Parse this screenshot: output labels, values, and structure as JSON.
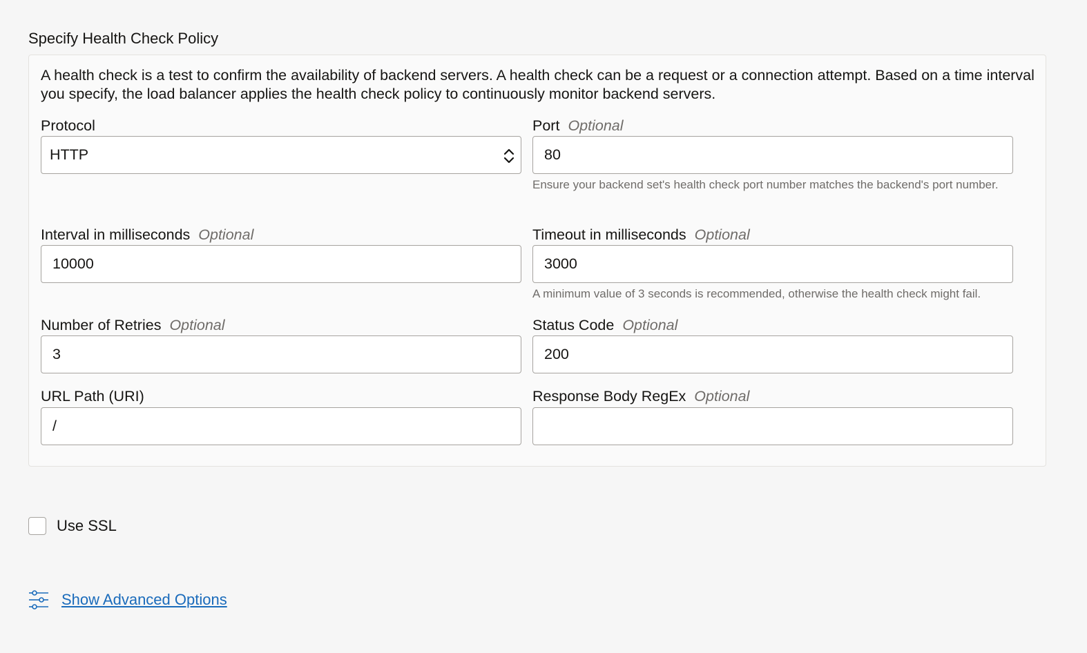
{
  "section": {
    "title": "Specify Health Check Policy",
    "description": "A health check is a test to confirm the availability of backend servers. A health check can be a request or a connection attempt. Based on a time interval you specify, the load balancer applies the health check policy to continuously monitor backend servers."
  },
  "optional_tag": "Optional",
  "fields": {
    "protocol": {
      "label": "Protocol",
      "value": "HTTP"
    },
    "port": {
      "label": "Port",
      "value": "80",
      "helper": "Ensure your backend set's health check port number matches the backend's port number."
    },
    "interval": {
      "label": "Interval in milliseconds",
      "value": "10000"
    },
    "timeout": {
      "label": "Timeout in milliseconds",
      "value": "3000",
      "helper": "A minimum value of 3 seconds is recommended, otherwise the health check might fail."
    },
    "retries": {
      "label": "Number of Retries",
      "value": "3"
    },
    "status_code": {
      "label": "Status Code",
      "value": "200"
    },
    "url_path": {
      "label": "URL Path (URI)",
      "value": "/"
    },
    "response_regex": {
      "label": "Response Body RegEx",
      "value": ""
    }
  },
  "ssl": {
    "label": "Use SSL",
    "checked": false
  },
  "advanced": {
    "label": "Show Advanced Options",
    "icon": "sliders-icon"
  },
  "colors": {
    "background": "#f6f6f6",
    "panel": "#fafafa",
    "border": "#a6a39f",
    "link": "#1a6bbb",
    "muted": "#6f6c69"
  }
}
